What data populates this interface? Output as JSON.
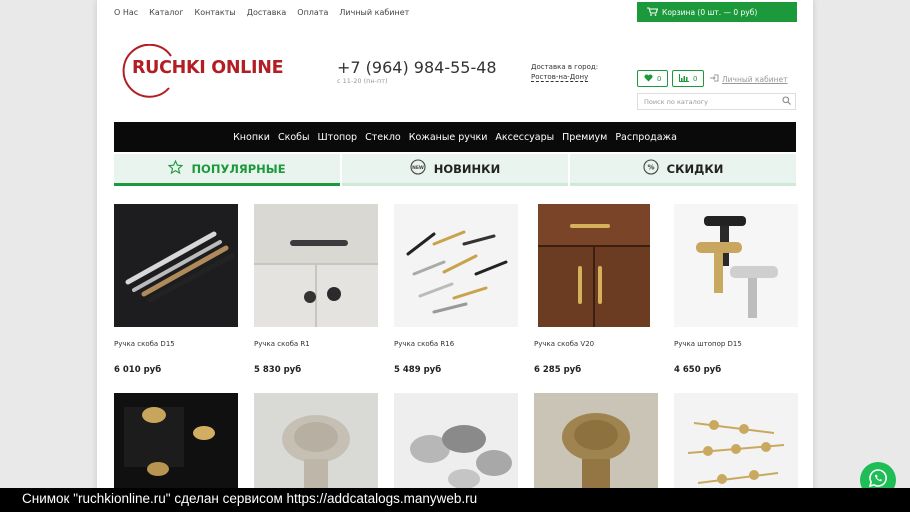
{
  "topnav": [
    "О Нас",
    "Каталог",
    "Контакты",
    "Доставка",
    "Оплата",
    "Личный кабинет"
  ],
  "cart": {
    "label": "Корзина (0 шт. — 0 руб)"
  },
  "logo": {
    "text": "RUCHKI ONLINE"
  },
  "contact": {
    "phone": "+7 (964) 984-55-48",
    "hours": "с 11-20 (пн-пт)"
  },
  "delivery": {
    "label": "Доставка в город:",
    "city": "Ростов-на-Дону"
  },
  "wishlist": {
    "count": "0"
  },
  "compare": {
    "count": "0"
  },
  "account": {
    "label": "Личный кабинет"
  },
  "search": {
    "placeholder": "Поиск по каталогу"
  },
  "categories": [
    "Кнопки",
    "Скобы",
    "Штопор",
    "Стекло",
    "Кожаные ручки",
    "Аксессуары",
    "Премиум",
    "Распродажа"
  ],
  "tabs": [
    {
      "label": "ПОПУЛЯРНЫЕ",
      "icon": "star-icon"
    },
    {
      "label": "НОВИНКИ",
      "icon": "new-badge-icon"
    },
    {
      "label": "СКИДКИ",
      "icon": "percent-icon"
    }
  ],
  "products": [
    {
      "name": "Ручка скоба D15",
      "price": "6 010 руб"
    },
    {
      "name": "Ручка скоба R1",
      "price": "5 830 руб"
    },
    {
      "name": "Ручка скоба R16",
      "price": "5 489 руб"
    },
    {
      "name": "Ручка скоба V20",
      "price": "6 285 руб"
    },
    {
      "name": "Ручка штопор D15",
      "price": "4 650 руб"
    }
  ],
  "caption": "Снимок \"ruchkionline.ru\" сделан сервисом https://addcatalogs.manyweb.ru",
  "colors": {
    "accent": "#1c9a3b",
    "brand": "#b21e23",
    "nav_bg": "#0a0a0a"
  }
}
